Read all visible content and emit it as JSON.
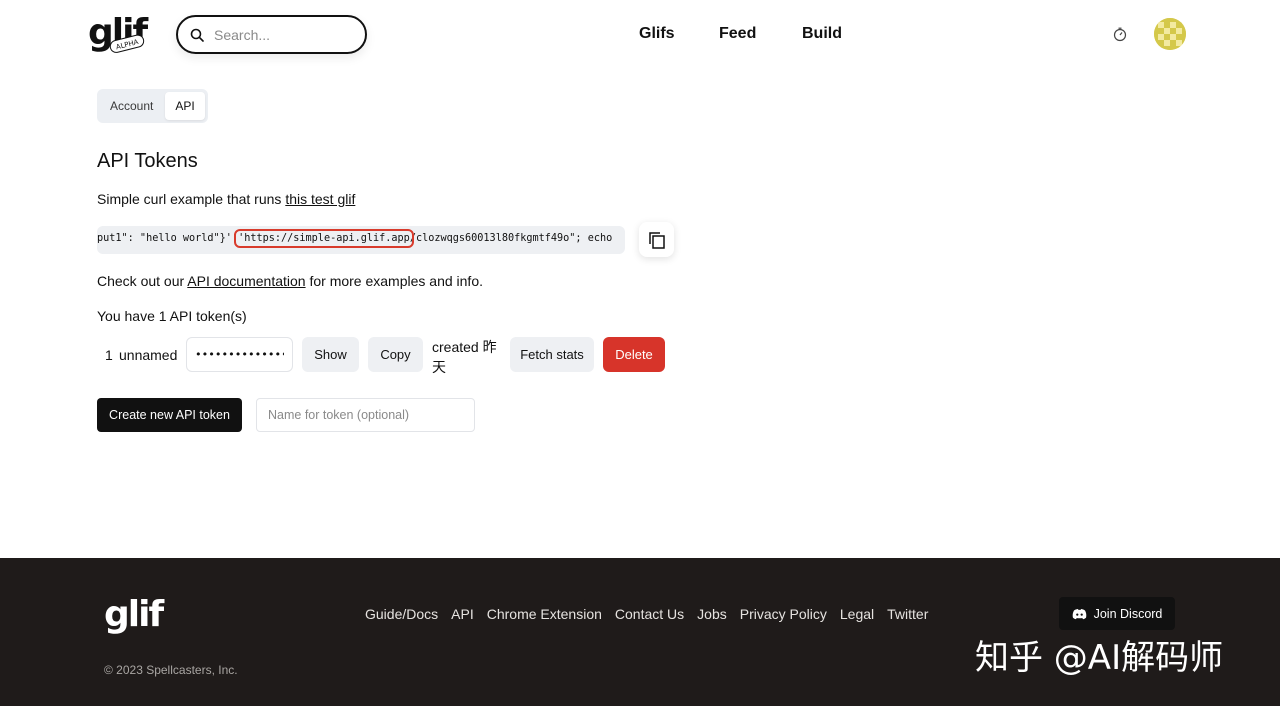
{
  "header": {
    "logo_text": "glif",
    "logo_badge": "ALPHA",
    "search_placeholder": "Search...",
    "nav": [
      "Glifs",
      "Feed",
      "Build"
    ]
  },
  "tabs": [
    {
      "label": "Account",
      "active": false
    },
    {
      "label": "API",
      "active": true
    }
  ],
  "page": {
    "title": "API Tokens",
    "curl_intro": "Simple curl example that runs ",
    "curl_link": "this test glif",
    "code_before": "put1\": \"hello world\"}' ",
    "code_highlight": "'https://simple-api.glif.app",
    "code_after": "/clozwqgs60013l80fkgmtf49o\"; echo",
    "docs_before": "Check out our ",
    "docs_link": "API documentation",
    "docs_after": " for more examples and info.",
    "token_count_text": "You have 1 API token(s)"
  },
  "tokens": [
    {
      "index": "1",
      "name": "unnamed",
      "value": "••••••••••••••••••",
      "show_label": "Show",
      "copy_label": "Copy",
      "created": "created 昨天",
      "fetch_label": "Fetch stats",
      "delete_label": "Delete"
    }
  ],
  "create": {
    "button_label": "Create new API token",
    "input_placeholder": "Name for token (optional)"
  },
  "footer": {
    "logo_text": "glif",
    "copyright": "© 2023 Spellcasters, Inc.",
    "links": [
      "Guide/Docs",
      "API",
      "Chrome Extension",
      "Contact Us",
      "Jobs",
      "Privacy Policy",
      "Legal",
      "Twitter"
    ],
    "discord_label": "Join Discord",
    "watermark": "知乎 @AI解码师"
  },
  "colors": {
    "delete": "#d7342a",
    "highlight_outline": "#d83b2c",
    "footer_bg": "#1f1b1a"
  }
}
